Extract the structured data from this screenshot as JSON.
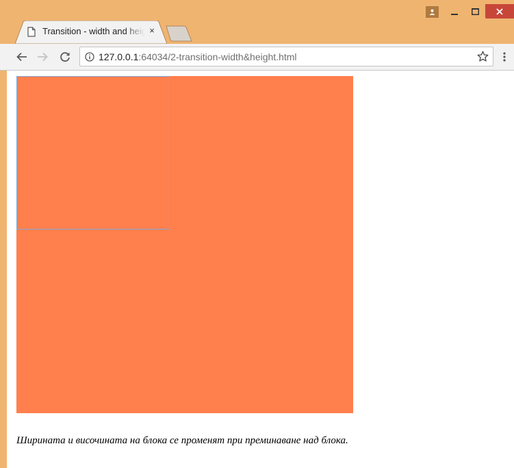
{
  "window": {
    "controls": {
      "profile": "person-icon",
      "minimize": "minimize-icon",
      "maximize": "maximize-icon",
      "close": "close-icon"
    }
  },
  "tabs": [
    {
      "title": "Transition - width and height",
      "active": true,
      "close_glyph": "×"
    }
  ],
  "toolbar": {
    "url_host": "127.0.0.1",
    "url_rest": ":64034/2-transition-width&height.html"
  },
  "page": {
    "caption": "Ширината и височината на блока се променят при преминаване над блока."
  },
  "colors": {
    "frame": "#efb470",
    "block": "#ff7f4d",
    "highlight": "#7fa9db",
    "close_button": "#c7463a"
  }
}
